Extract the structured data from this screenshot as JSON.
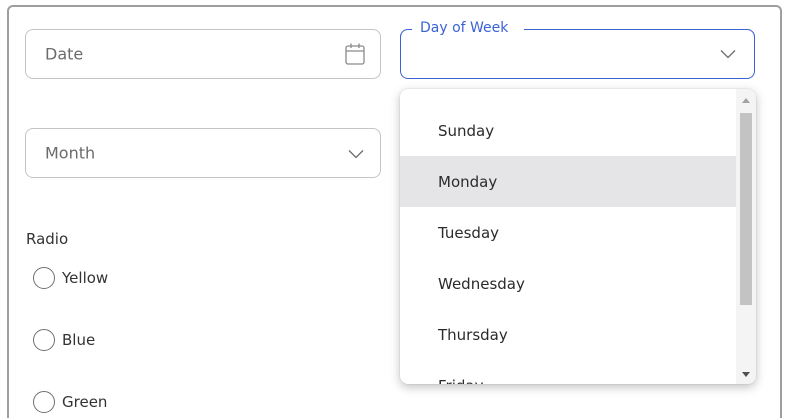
{
  "date_field": {
    "placeholder": "Date",
    "icon": "calendar-icon"
  },
  "day_of_week_field": {
    "label": "Day of Week",
    "value": "",
    "icon": "chevron-down-icon"
  },
  "month_field": {
    "placeholder": "Month",
    "icon": "chevron-down-icon"
  },
  "radio_group": {
    "heading": "Radio",
    "options": [
      {
        "label": "Yellow",
        "checked": false
      },
      {
        "label": "Blue",
        "checked": false
      },
      {
        "label": "Green",
        "checked": false
      }
    ]
  },
  "day_dropdown": {
    "options": [
      "Sunday",
      "Monday",
      "Tuesday",
      "Wednesday",
      "Thursday",
      "Friday"
    ],
    "highlighted_option": "Monday"
  },
  "colors": {
    "accent": "#3b63d6",
    "border": "#c4c4c4",
    "highlight": "#e5e5e8",
    "card_border": "#9e9e9e"
  }
}
